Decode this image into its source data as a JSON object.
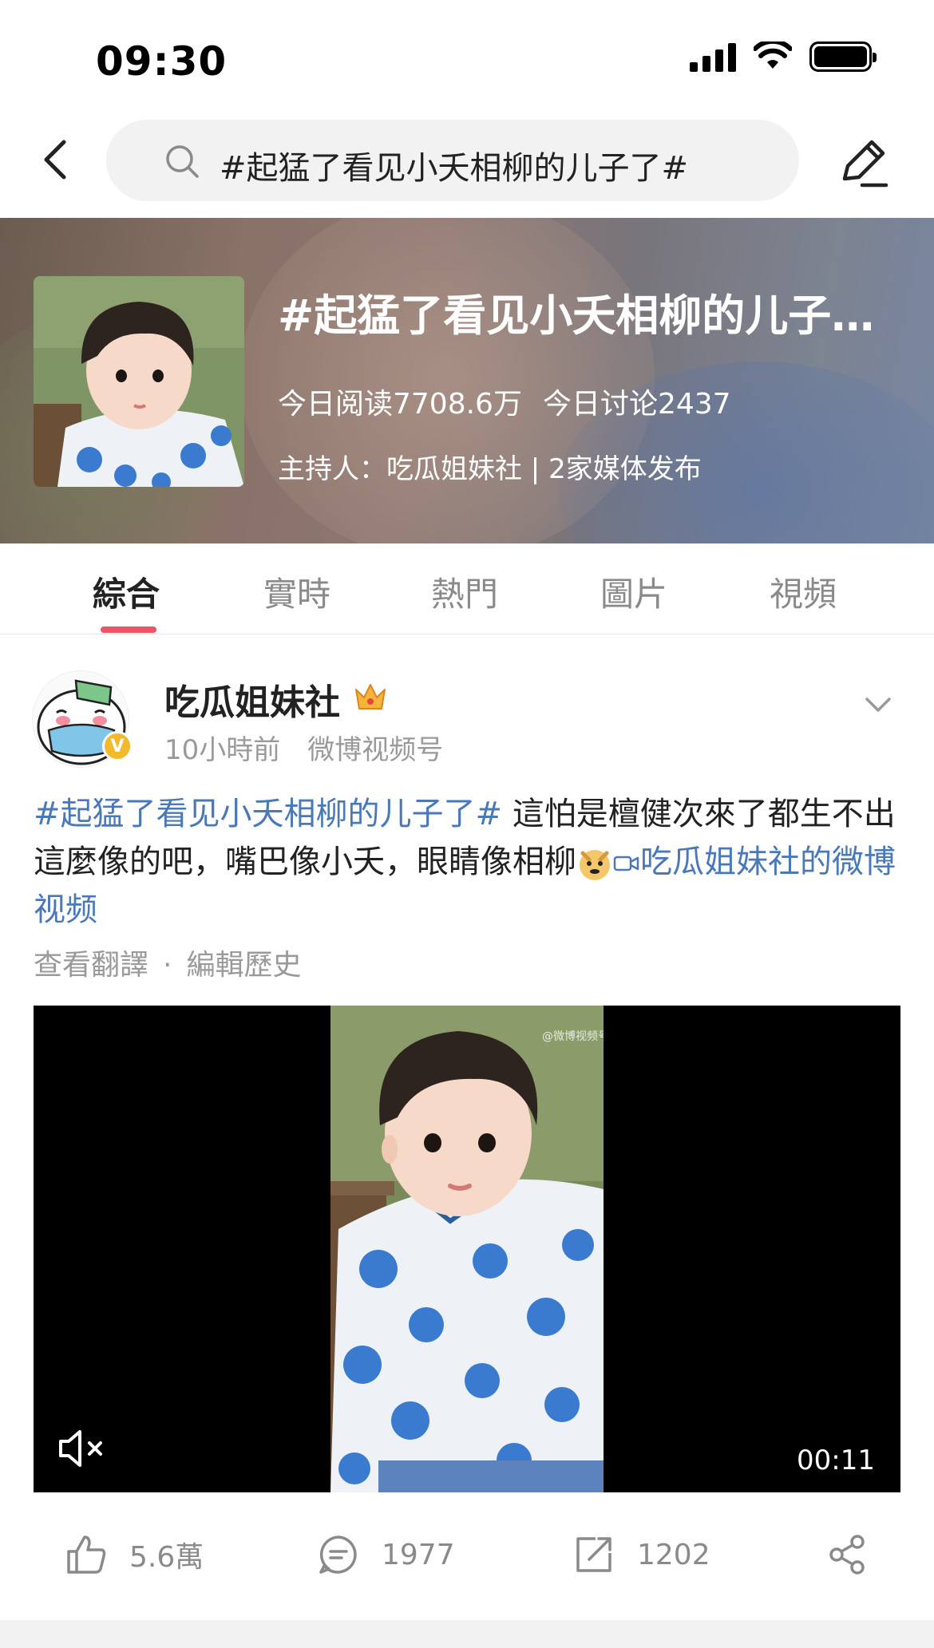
{
  "status_bar": {
    "time": "09:30"
  },
  "search": {
    "query": "#起猛了看见小夭相柳的儿子了#"
  },
  "topic": {
    "title": "#起猛了看见小夭相柳的儿子了#",
    "reads": "今日阅读7708.6万",
    "discussions": "今日讨论2437",
    "host": "主持人：吃瓜姐妹社 | 2家媒体发布"
  },
  "tabs": [
    "綜合",
    "實時",
    "熱門",
    "圖片",
    "視頻"
  ],
  "post": {
    "author": "吃瓜姐妹社",
    "verify_mark": "V",
    "time": "10小時前",
    "source": "微博视频号",
    "hashtag": "#起猛了看见小夭相柳的儿子了#",
    "body": " 這怕是檀健次來了都生不出這麼像的吧，嘴巴像小夭，眼睛像相柳",
    "video_link": "吃瓜姐妹社的微博视频",
    "translate": "查看翻譯",
    "separator": "·",
    "edit_history": "編輯歷史",
    "video_duration": "00:11",
    "watermark": "@微博视频号",
    "likes": "5.6萬",
    "comments": "1977",
    "reposts": "1202"
  },
  "colors": {
    "accent": "#ec5468",
    "link": "#4a78b9",
    "muted": "#9a9a9a"
  },
  "icons": [
    "back-icon",
    "search-icon",
    "edit-icon",
    "crown-icon",
    "chevron-down-icon",
    "mute-icon",
    "like-icon",
    "comment-icon",
    "repost-icon",
    "share-icon"
  ]
}
